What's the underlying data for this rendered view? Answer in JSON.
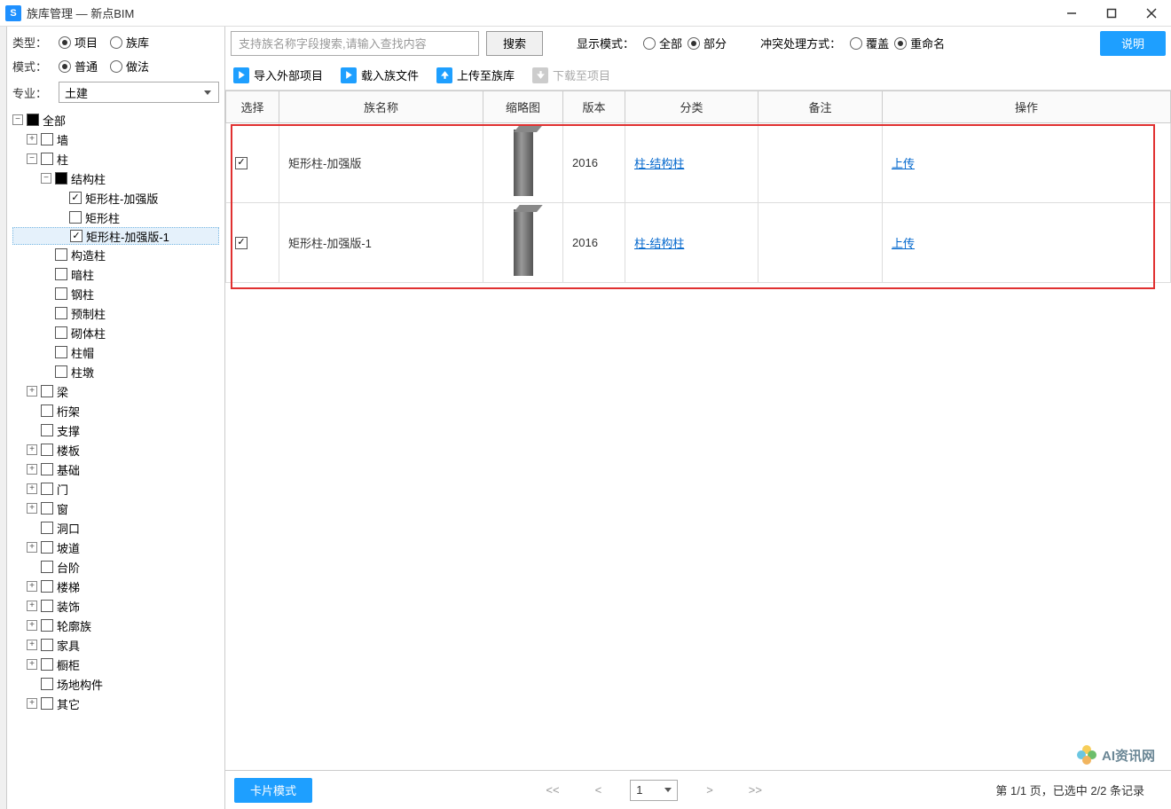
{
  "window": {
    "title": "族库管理 — 新点BIM",
    "icon_letter": "S"
  },
  "sidebar": {
    "type_label": "类型：",
    "type_options": {
      "project": "项目",
      "library": "族库"
    },
    "type_selected": "project",
    "mode_label": "模式：",
    "mode_options": {
      "normal": "普通",
      "method": "做法"
    },
    "mode_selected": "normal",
    "discipline_label": "专业：",
    "discipline_value": "土建"
  },
  "tree": {
    "root": "全部",
    "nodes": [
      {
        "label": "墙",
        "expandable": true
      },
      {
        "label": "柱",
        "expanded": true,
        "expandable": true,
        "children": [
          {
            "label": "结构柱",
            "expanded": true,
            "expandable": true,
            "filled": true,
            "children": [
              {
                "label": "矩形柱-加强版",
                "checked": true
              },
              {
                "label": "矩形柱",
                "checked": false
              },
              {
                "label": "矩形柱-加强版-1",
                "checked": true,
                "selected": true
              }
            ]
          },
          {
            "label": "构造柱"
          },
          {
            "label": "暗柱"
          },
          {
            "label": "钢柱"
          },
          {
            "label": "预制柱"
          },
          {
            "label": "砌体柱"
          },
          {
            "label": "柱帽"
          },
          {
            "label": "柱墩"
          }
        ]
      },
      {
        "label": "梁",
        "expandable": true
      },
      {
        "label": "桁架"
      },
      {
        "label": "支撑"
      },
      {
        "label": "楼板",
        "expandable": true
      },
      {
        "label": "基础",
        "expandable": true
      },
      {
        "label": "门",
        "expandable": true
      },
      {
        "label": "窗",
        "expandable": true
      },
      {
        "label": "洞口"
      },
      {
        "label": "坡道",
        "expandable": true
      },
      {
        "label": "台阶"
      },
      {
        "label": "楼梯",
        "expandable": true
      },
      {
        "label": "装饰",
        "expandable": true
      },
      {
        "label": "轮廓族",
        "expandable": true
      },
      {
        "label": "家具",
        "expandable": true
      },
      {
        "label": "橱柜",
        "expandable": true
      },
      {
        "label": "场地构件"
      },
      {
        "label": "其它",
        "expandable": true
      }
    ]
  },
  "toolbar": {
    "search_placeholder": "支持族名称字段搜索,请输入查找内容",
    "search_btn": "搜索",
    "display_mode_label": "显示模式：",
    "display_options": {
      "all": "全部",
      "part": "部分"
    },
    "display_selected": "part",
    "conflict_label": "冲突处理方式：",
    "conflict_options": {
      "overwrite": "覆盖",
      "rename": "重命名"
    },
    "conflict_selected": "rename",
    "explain_btn": "说明",
    "actions": {
      "import": "导入外部项目",
      "load": "载入族文件",
      "upload": "上传至族库",
      "download": "下载至项目"
    }
  },
  "table": {
    "headers": {
      "select": "选择",
      "name": "族名称",
      "thumb": "缩略图",
      "version": "版本",
      "category": "分类",
      "remark": "备注",
      "action": "操作"
    },
    "rows": [
      {
        "checked": true,
        "name": "矩形柱-加强版",
        "version": "2016",
        "category": "柱-结构柱",
        "action": "上传"
      },
      {
        "checked": true,
        "name": "矩形柱-加强版-1",
        "version": "2016",
        "category": "柱-结构柱",
        "action": "上传"
      }
    ]
  },
  "footer": {
    "card_mode": "卡片模式",
    "first": "<<",
    "prev": "<",
    "next": ">",
    "last": ">>",
    "page": "1",
    "status": "第 1/1 页，已选中 2/2 条记录"
  },
  "watermark": "AI资讯网"
}
